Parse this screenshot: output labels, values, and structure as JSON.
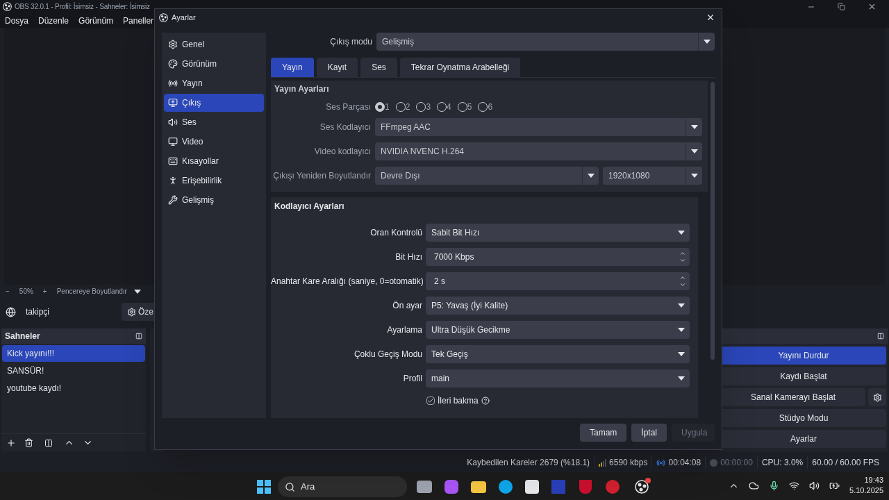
{
  "main_window": {
    "title": "OBS 32.0.1 - Profil: İsimsiz - Sahneler: İsimsiz",
    "menu": [
      "Dosya",
      "Düzenle",
      "Görünüm",
      "Paneller"
    ],
    "zoom_bar": {
      "minus": "−",
      "zoom": "50%",
      "plus": "+",
      "fit": "Pencereye Boyutlandır"
    },
    "source_bar": {
      "source": "takipçi",
      "button": "Öze"
    },
    "scenes": {
      "title": "Sahneler",
      "items": [
        {
          "label": "Kick yayını!!!",
          "selected": true
        },
        {
          "label": "SANSÜR!",
          "selected": false
        },
        {
          "label": "youtube kaydı!",
          "selected": false
        }
      ]
    },
    "controls": [
      {
        "label": "Yayını Durdur",
        "active": true,
        "gear": false
      },
      {
        "label": "Kaydı Başlat",
        "active": false,
        "gear": false
      },
      {
        "label": "Sanal Kamerayı Başlat",
        "active": false,
        "gear": true
      },
      {
        "label": "Stüdyo Modu",
        "active": false,
        "gear": false
      },
      {
        "label": "Ayarlar",
        "active": false,
        "gear": false
      }
    ],
    "status_bar": {
      "dropped": "Kaybedilen Kareler 2679 (%18.1)",
      "bitrate": "6590 kbps",
      "stream_time": "00:04:08",
      "record_time": "00:00:00",
      "cpu": "CPU: 3.0%",
      "fps": "60.00 / 60.00 FPS"
    }
  },
  "dialog": {
    "title": "Ayarlar",
    "sidebar": [
      {
        "label": "Genel",
        "selected": false
      },
      {
        "label": "Görünüm",
        "selected": false
      },
      {
        "label": "Yayın",
        "selected": false
      },
      {
        "label": "Çıkış",
        "selected": true
      },
      {
        "label": "Ses",
        "selected": false
      },
      {
        "label": "Video",
        "selected": false
      },
      {
        "label": "Kısayollar",
        "selected": false
      },
      {
        "label": "Erişebilirlik",
        "selected": false
      },
      {
        "label": "Gelişmiş",
        "selected": false
      }
    ],
    "output_mode": {
      "label": "Çıkış modu",
      "value": "Gelişmiş"
    },
    "tabs": [
      {
        "label": "Yayın",
        "selected": true
      },
      {
        "label": "Kayıt",
        "selected": false
      },
      {
        "label": "Ses",
        "selected": false
      },
      {
        "label": "Tekrar Oynatma Arabelleği",
        "selected": false
      }
    ],
    "stream_settings": {
      "title": "Yayın Ayarları",
      "track_label": "Ses Parçası",
      "tracks": [
        {
          "label": "1",
          "selected": true
        },
        {
          "label": "2",
          "selected": false
        },
        {
          "label": "3",
          "selected": false
        },
        {
          "label": "4",
          "selected": false
        },
        {
          "label": "5",
          "selected": false
        },
        {
          "label": "6",
          "selected": false
        }
      ],
      "fields": [
        {
          "label": "Ses Kodlayıcı",
          "value": "FFmpeg AAC"
        },
        {
          "label": "Video kodlayıcı",
          "value": "NVIDIA NVENC H.264"
        }
      ],
      "rescale": {
        "label": "Çıkışı Yeniden Boyutlandır",
        "value": "Devre Dışı",
        "resolution": "1920x1080"
      }
    },
    "encoder_settings": {
      "title": "Kodlayıcı Ayarları",
      "fields": [
        {
          "kind": "select",
          "label": "Oran Kontrolü",
          "value": "Sabit Bit Hızı"
        },
        {
          "kind": "spin",
          "label": "Bit Hızı",
          "value": "7000 Kbps"
        },
        {
          "kind": "spin",
          "label": "Anahtar Kare Aralığı (saniye, 0=otomatik)",
          "value": "2 s"
        },
        {
          "kind": "select",
          "label": "Ön ayar",
          "value": "P5: Yavaş (İyi Kalite)"
        },
        {
          "kind": "select",
          "label": "Ayarlama",
          "value": "Ultra Düşük Gecikme"
        },
        {
          "kind": "select",
          "label": "Çoklu Geçiş Modu",
          "value": "Tek Geçiş"
        },
        {
          "kind": "select",
          "label": "Profil",
          "value": "main"
        }
      ],
      "checks": [
        {
          "label": "İleri bakma",
          "checked": true
        }
      ]
    },
    "buttons": [
      {
        "label": "Tamam",
        "disabled": false
      },
      {
        "label": "İptal",
        "disabled": false
      },
      {
        "label": "Uygula",
        "disabled": true
      }
    ]
  },
  "taskbar": {
    "search": "Ara",
    "time": "19:43",
    "date": "5.10.2025"
  }
}
